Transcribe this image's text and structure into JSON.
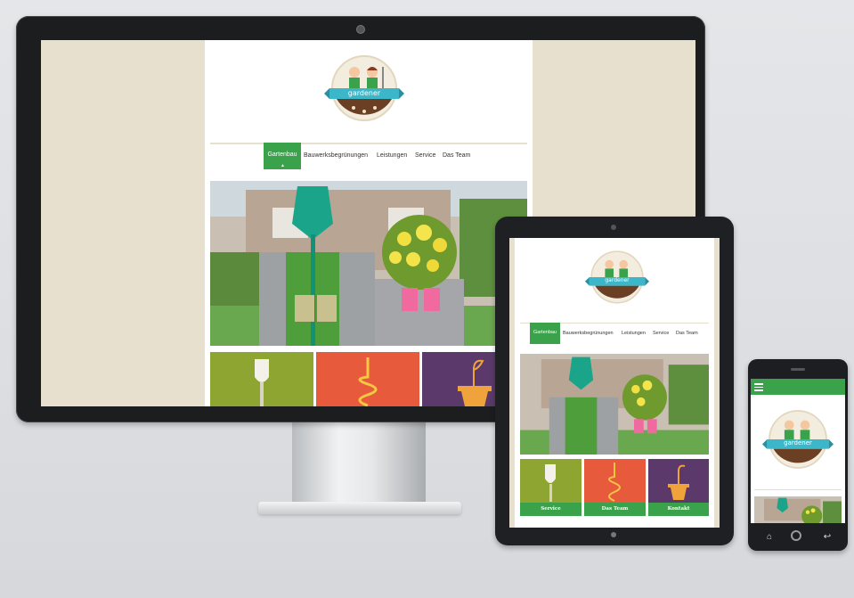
{
  "colors": {
    "brand_green": "#39a24a",
    "teal": "#3cb7c9",
    "orange": "#e85a3c",
    "olive": "#8ea532",
    "purple": "#5b3a6b",
    "cream": "#e7e0cf"
  },
  "logo": {
    "text": "gardener"
  },
  "nav": {
    "items": [
      "Gartenbau",
      "Bauwerksbegrünungen",
      "Leistungen",
      "Service",
      "Das Team"
    ],
    "active": "Gartenbau"
  },
  "tiles": [
    {
      "label": "Service",
      "icon": "shovel-icon",
      "color": "#8ea532"
    },
    {
      "label": "Das Team",
      "icon": "hose-icon",
      "color": "#e85a3c"
    },
    {
      "label": "Kontakt",
      "icon": "plant-pot-icon",
      "color": "#5b3a6b"
    }
  ],
  "phone": {
    "menu_icon": "hamburger-menu-icon",
    "home_icon": "home-icon",
    "back_icon": "back-icon"
  }
}
